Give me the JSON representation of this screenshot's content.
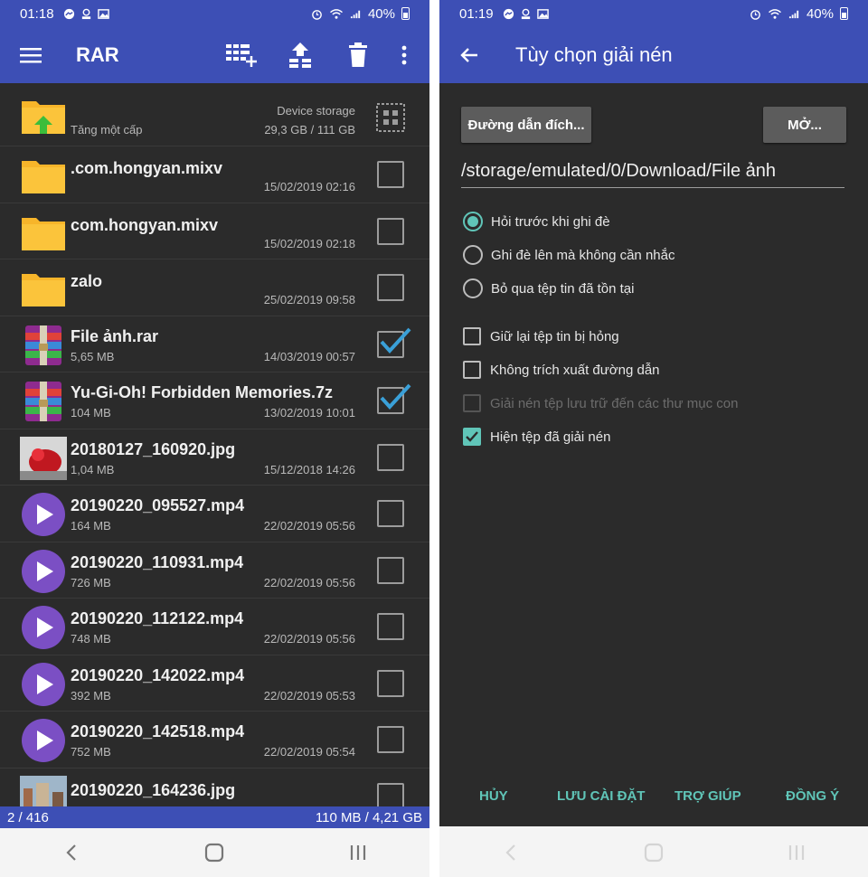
{
  "colors": {
    "app_bar": "#3d4fb5",
    "list_background": "#2b2b2b",
    "accent": "#60c5b8",
    "checkbox_checked": "#3aa0d8"
  },
  "left_screen": {
    "status": {
      "time": "01:18",
      "battery": "40%"
    },
    "app_bar": {
      "title": "RAR",
      "icons": [
        "menu-icon",
        "add-to-archive-icon",
        "extract-icon",
        "delete-icon",
        "more-vert-icon"
      ]
    },
    "parent_row": {
      "label": "Tăng một cấp",
      "storage_name": "Device storage",
      "storage_usage": "29,3 GB / 111 GB"
    },
    "files": [
      {
        "name": ".com.hongyan.mixv",
        "size": "",
        "date": "15/02/2019 02:16",
        "type": "folder",
        "checked": false
      },
      {
        "name": "com.hongyan.mixv",
        "size": "",
        "date": "15/02/2019 02:18",
        "type": "folder",
        "checked": false
      },
      {
        "name": "zalo",
        "size": "",
        "date": "25/02/2019 09:58",
        "type": "folder",
        "checked": false
      },
      {
        "name": "File ảnh.rar",
        "size": "5,65 MB",
        "date": "14/03/2019 00:57",
        "type": "archive",
        "checked": true
      },
      {
        "name": "Yu-Gi-Oh! Forbidden Memories.7z",
        "size": "104 MB",
        "date": "13/02/2019 10:01",
        "type": "archive",
        "checked": true
      },
      {
        "name": "20180127_160920.jpg",
        "size": "1,04 MB",
        "date": "15/12/2018 14:26",
        "type": "image",
        "checked": false
      },
      {
        "name": "20190220_095527.mp4",
        "size": "164 MB",
        "date": "22/02/2019 05:56",
        "type": "video",
        "checked": false
      },
      {
        "name": "20190220_110931.mp4",
        "size": "726 MB",
        "date": "22/02/2019 05:56",
        "type": "video",
        "checked": false
      },
      {
        "name": "20190220_112122.mp4",
        "size": "748 MB",
        "date": "22/02/2019 05:56",
        "type": "video",
        "checked": false
      },
      {
        "name": "20190220_142022.mp4",
        "size": "392 MB",
        "date": "22/02/2019 05:53",
        "type": "video",
        "checked": false
      },
      {
        "name": "20190220_142518.mp4",
        "size": "752 MB",
        "date": "22/02/2019 05:54",
        "type": "video",
        "checked": false
      },
      {
        "name": "20190220_164236.jpg",
        "size": "",
        "date": "",
        "type": "image2",
        "checked": false
      }
    ],
    "footer": {
      "selection": "2 / 416",
      "usage": "110 MB / 4,21 GB"
    }
  },
  "right_screen": {
    "status": {
      "time": "01:19",
      "battery": "40%"
    },
    "app_bar": {
      "title": "Tùy chọn giải nén"
    },
    "destination_button": "Đường dẫn đích...",
    "open_button": "MỞ...",
    "destination_path": "/storage/emulated/0/Download/File ảnh",
    "overwrite_options": [
      {
        "label": "Hỏi trước khi ghi đè",
        "selected": true
      },
      {
        "label": "Ghi đè lên mà không cần nhắc",
        "selected": false
      },
      {
        "label": "Bỏ qua tệp tin đã tồn tại",
        "selected": false
      }
    ],
    "checkbox_options": [
      {
        "label": "Giữ lại tệp tin bị hỏng",
        "checked": false,
        "disabled": false
      },
      {
        "label": "Không trích xuất đường dẫn",
        "checked": false,
        "disabled": false
      },
      {
        "label": "Giải nén tệp lưu trữ đến các thư mục con",
        "checked": false,
        "disabled": true
      },
      {
        "label": "Hiện tệp đã giải nén",
        "checked": true,
        "disabled": false
      }
    ],
    "actions": {
      "cancel": "HỦY",
      "save_settings": "LƯU CÀI ĐẶT",
      "help": "TRỢ GIÚP",
      "ok": "ĐỒNG Ý"
    }
  }
}
